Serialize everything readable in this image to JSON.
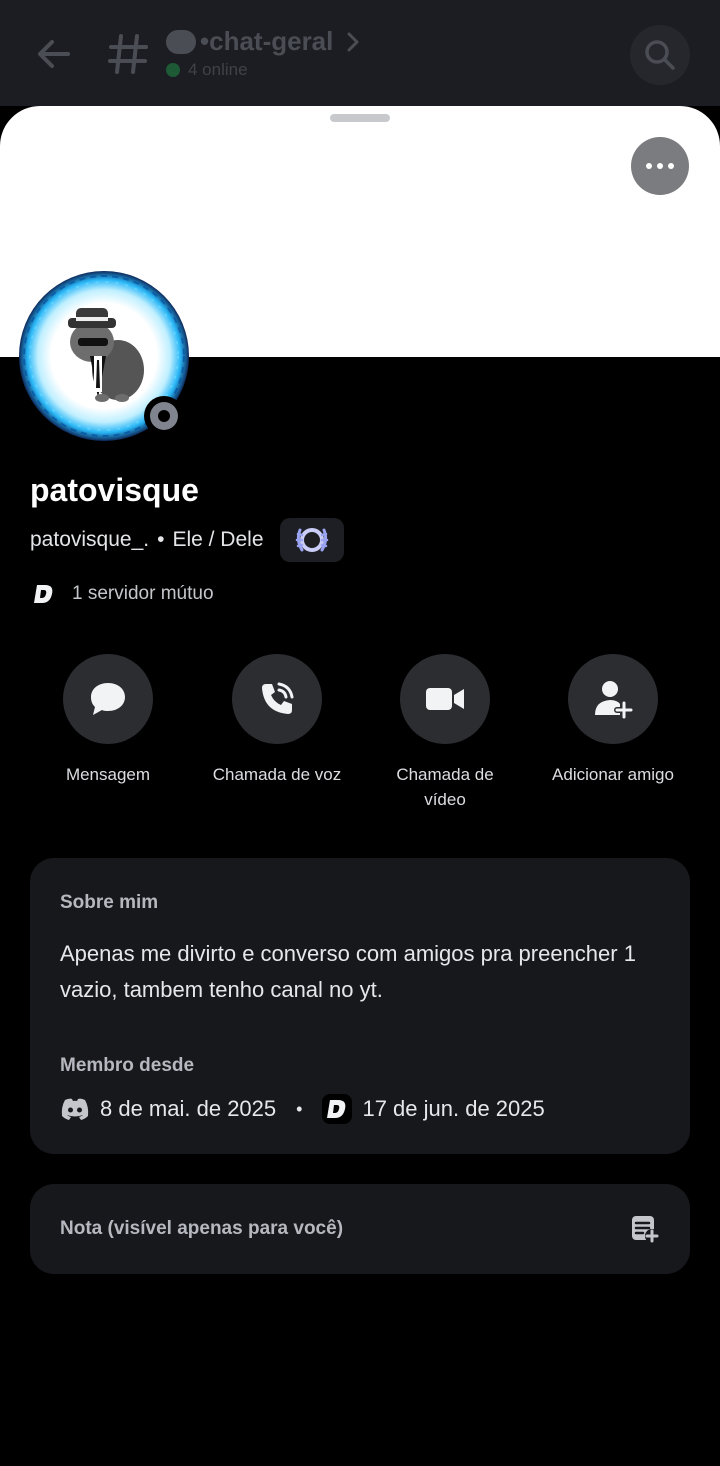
{
  "header": {
    "channel_name": "•chat-geral",
    "online_text": "4 online"
  },
  "profile": {
    "display_name": "patovisque",
    "username": "patovisque_.",
    "separator": "•",
    "pronouns": "Ele / Dele",
    "mutual_servers": "1 servidor mútuo"
  },
  "actions": [
    {
      "label": "Mensagem",
      "icon": "chat-bubble-icon"
    },
    {
      "label": "Chamada de voz",
      "icon": "phone-call-icon"
    },
    {
      "label": "Chamada de vídeo",
      "icon": "video-camera-icon"
    },
    {
      "label": "Adicionar amigo",
      "icon": "add-friend-icon"
    }
  ],
  "about": {
    "heading": "Sobre mim",
    "bio": "Apenas me divirto e converso com amigos pra preencher 1 vazio, tambem tenho canal no yt.",
    "member_since_heading": "Membro desde",
    "discord_date": "8 de mai. de 2025",
    "dot": "•",
    "server_date": "17 de jun. de 2025"
  },
  "note": {
    "label": "Nota (visível apenas para você)"
  },
  "colors": {
    "background": "#000000",
    "card": "#17181c",
    "button_circle": "#2b2d31",
    "banner": "#ffffff",
    "status_offline": "#80848e"
  }
}
